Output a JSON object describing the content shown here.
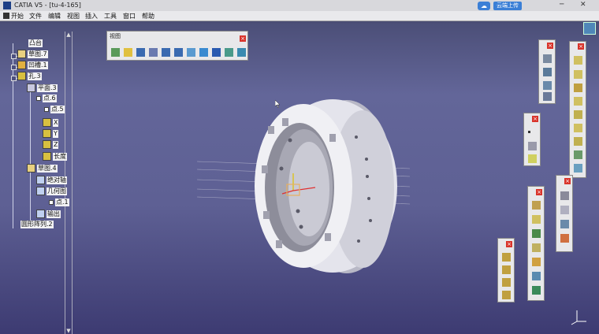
{
  "window": {
    "title": "CATIA V5 - [tu-4-165]",
    "cloud_button": "云端上传"
  },
  "menu": {
    "items": [
      "开始",
      "文件",
      "编辑",
      "视图",
      "插入",
      "工具",
      "窗口",
      "帮助"
    ]
  },
  "tree": {
    "nodes": [
      {
        "label": "凸台"
      },
      {
        "label": "草图.7"
      },
      {
        "label": "凹槽.1"
      },
      {
        "label": "孔.3"
      },
      {
        "label": "平面.3"
      },
      {
        "label": "点.6"
      },
      {
        "label": "点.5"
      },
      {
        "label": "X"
      },
      {
        "label": "Y"
      },
      {
        "label": "Z"
      },
      {
        "label": "长度"
      },
      {
        "label": "草图.4"
      },
      {
        "label": "绝对轴"
      },
      {
        "label": "几何图"
      },
      {
        "label": "点.1"
      },
      {
        "label": "输出"
      },
      {
        "label": "圆形阵列.2"
      }
    ]
  },
  "toolbar_view": {
    "title": "视图",
    "icons": [
      "fly-mode-icon",
      "fit-all-icon",
      "pan-icon",
      "rotate-icon",
      "zoom-in-icon",
      "zoom-out-icon",
      "normal-view-icon",
      "quick-view-icon",
      "shading-icon",
      "hide-show-icon",
      "swap-space-icon"
    ]
  },
  "colors": {
    "accent": "#3b7fd6",
    "close": "#d9342b",
    "part_surface": "#dcdce4"
  }
}
